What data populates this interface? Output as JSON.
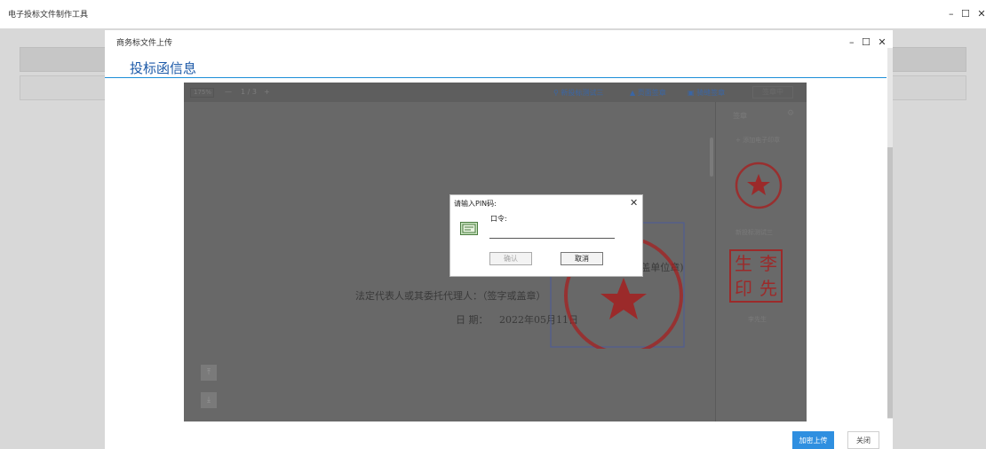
{
  "app": {
    "title": "电子投标文件制作工具",
    "window_controls": [
      "–",
      "☐",
      "✕"
    ]
  },
  "dialog": {
    "title": "商务标文件上传",
    "window_controls": [
      "–",
      "☐",
      "✕"
    ],
    "section_title": "投标函信息",
    "primary_button": "加密上传",
    "secondary_button": "关闭"
  },
  "pdf_viewer": {
    "toolbar": {
      "zoom": "175%",
      "zoom_out": "—",
      "page_indicator": "1 / 3",
      "zoom_in": "+",
      "signer_name": "新投标测试三",
      "page_stamp": "页面签章",
      "seam_stamp": "骑缝签章",
      "stamp_done": "签章中"
    },
    "page_text": {
      "stamp_note": "(盖单位章)",
      "legal_rep": "法定代表人或其委托代理人：（签字或盖章）",
      "date_label": "日   期：",
      "date_value": "2022年05月11日"
    },
    "nav": {
      "top": "⤒",
      "bottom": "⤓"
    },
    "seal_panel": {
      "title": "签章",
      "gear_icon": "⚙",
      "add_seal": "+ 添加电子印章",
      "seals": [
        {
          "label": "新投标测试三",
          "type": "round-seal"
        },
        {
          "label": "李先生",
          "type": "square-seal",
          "chars": [
            "生",
            "李",
            "印",
            "先"
          ]
        }
      ]
    }
  },
  "pin_dialog": {
    "title": "请输入PIN码:",
    "close": "✕",
    "label": "口令:",
    "input_value": "",
    "confirm_button": "确认",
    "cancel_button": "取消"
  },
  "colors": {
    "accent": "#2f8fe0",
    "section_title": "#1d5aa8",
    "seal_red": "#d02020"
  }
}
